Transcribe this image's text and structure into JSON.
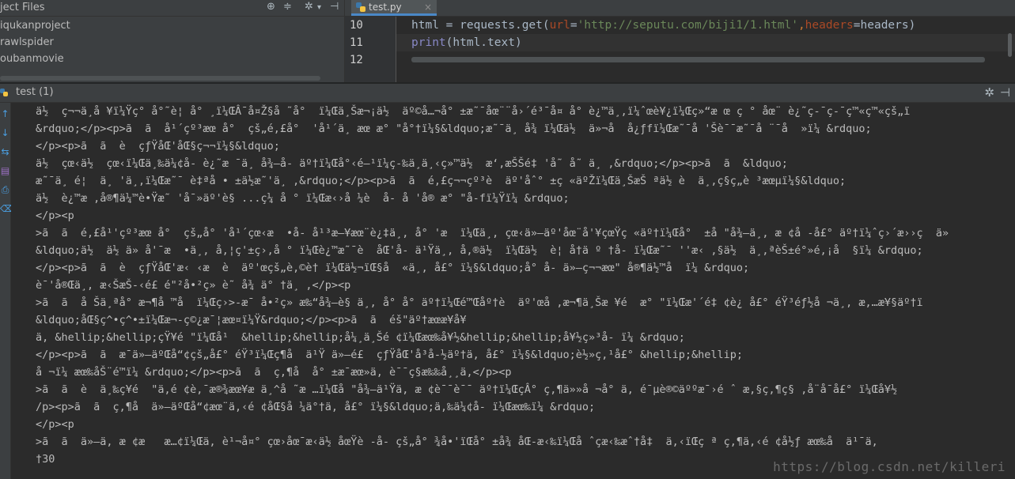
{
  "project_panel": {
    "title": "ject Files",
    "items": [
      "iqukanproject",
      "rawlspider",
      "oubanmovie"
    ]
  },
  "editor": {
    "tab_label": "test.py",
    "line_numbers": [
      "10",
      "11",
      "12"
    ],
    "line10": {
      "var": "html",
      "eq": " = ",
      "obj": "requests.",
      "fn": "get",
      "open": "(",
      "p1": "url",
      "eq1": "=",
      "url": "'http://seputu.com/biji1/1.html'",
      "comma": ",",
      "p2": "headers",
      "eq2": "=",
      "arg2": "headers",
      "close": ")"
    },
    "line11": {
      "fn": "print",
      "open": "(",
      "obj": "html.",
      "attr": "text",
      "close": ")"
    }
  },
  "run_panel": {
    "tab_label": "test (1)",
    "output_lines": [
      "ä½  ç¬¬ä¸å ¥ï¼Ÿç° å°˜è¦ å° ¸ï¼ŒÂ¯å¤Ž§å ˜å°  ï¼Œä¸Šæ¬¡ä½  äº©å…¬å° ±æ˜¯åœ¨¨å›´é³¯å¤ å° è¿™ä¸‚ï¼ˆœè¥¿ï¼Œç»“æ œ ç ° åœ¨ è¿˜ç-¯ç-¯ç™«ç™«çš„ï",
      "&rdquo;</p><p>ã  ã  å¹´çº³æœ å°  çš„é‚£å°  'å¹´ä¸ æœ æ° \"å°†ï¼§&ldquo;æ˜¯ä¸ å¾ ï¼Œä½  ä»¬å  å¿ƒfï¼Œæ˜¯å 'Šè¯¯æ˜¯å ¨¯å  »ï¼ &rdquo;",
      "</p><p>ã  ã  è  çƒŸåŒ'åŒ§ç¬¬ï¼§&ldquo;",
      "ä½  çœ‹ä½  çœ‹ï¼Œä¸‰ä¼¢å- è¿˜æ ¯ä¸ å¾–å- äº†ï¼Œå°‹é—¹ï¼ç-‰ä¸ä¸‹ç»™ä½  æ‘‚æŠŠé‡ 'å˜ å˜ ä¸ ,&rdquo;</p><p>ã  ã  &ldquo;",
      "æ˜¯ä¸ é¦  ä¸ 'ä¸‚ï¼Œæ˜¯ è‡ªå • ±ä½æ˜'ä¸ ,&rdquo;</p><p>ã  ã  é‚£ç¬¬çº³è  äº'åˆ° ±ç «äºŽï¼Œä¸ŠæŠ ªä½ è  ä¸‚ç§ç„è ³æœµï¼§&ldquo;",
      "ä½  è¿™æ ,å®¶ä¼™è•Ÿæ˜ 'å¯»äº'è§ ...ç¼ å ° ï¼Œæ‹›å ¼è  å- å 'å® æ° \"å-fï¼Ÿï¼ &rdquo;",
      "</p><p",
      ">ã  ã  é,£å¹'çº³æœ å°  çš„å° 'å¹´çœ‹æ  •å- å¹³æ—¥æœ¨è¿‡ä¸, å° 'æ  ï¼Œä¸, çœ‹ä»–äº'åœ¨å'¥çœŸç «äº†ï¼Œå°  ±å \"å¾–ä¸, æ ¢å -å£° äº†ï¼ˆç›´æ››ç  ä»",
      "&ldquo;ä½  ä½ ä» å'¯æ  •ä¸, å,¦ç'±ç›,å ° ï¼Œè¿™æ˜¯è  åŒ'å- ä¹Ÿä¸, å,®ä½  ï¼Œä½  è¦ å†ä º †å- ï¼Œæ˜¯ ''æ‹ ,§ä½  ä¸,ªèŠ±é°»é,¡å  §ï¼ &rdquo;",
      "</p><p>ã  ã  è  çƒŸåŒ'æ‹ ‹æ  è  äº'œçš„è,©è† ï¼Œä½¬ïŒ§å  «ä¸, å£° ï¼§&ldquo;å° å- ä»–ç¬¬æœ\" å®¶ä½™å  ï¼ &rdquo;",
      "è¯'å®Œä¸, æ‹ŠæŠ-‹é£ é\"²å•²ç» è˜ å¾ ä° †ä¸ ,</p><p",
      ">ã  ã  å Šä¸ªå° æ¬¶å ™å  ï¼Œç›>-æ¯ å•²ç» æ‰“å¾–è§ ä¸, å° å° äº†ï¼Œé™Œåº†è  äº'œå ,æ¬¶ä¸Šæ ¥é  æ° \"ï¼Œæ'´é‡ ¢è¿ å£° éŸ³éƒ½å ¬ä¸, æ,…æ¥§äº†ï",
      "&ldquo;åŒ§ç^•ç^•±ï¼Œæ¬-ç©¿æ¯¦æœ¤ï¼Ÿ&rdquo;</p><p>ã  ã  éš\"äº†æœæ¥å¥",
      "ä, &hellip;&hellip;çŸ¥é \"ï¼Œå¹  &hellip;&hellip;å¼¸ä¸Šé ¢ï¼Œæœ‰å¥½&hellip;&hellip;å¥½ç»³å- ï¼ &rdquo;",
      "</p><p>ã  ã  æ¯ä»–äºŒå“¢çš„å£° éŸ³ï¼Œç¶å  ä¹Ÿ ä»–é£  çƒŸåŒ'å³å-½äº†ä, å£° ï¼§&ldquo;è½»ç,¹å£° &hellip;&hellip;",
      "å ¬ï¼ æœ‰åŠ¨é™ï¼ &rdquo;</p><p>ã  ã  ç,¶å  å° ±æ¯æœ»ä, è¯¯ç§æ‰‰å¸¸ä,</p><p",
      ">ã  ã  è  ä¸‰ç¥é  \"ä,é ¢è,¯æ®¾æœ¥æ ä¸^å ˜æ …ï¼Œå \"å¾–ä¹Ÿä, æ ¢è¯¯è¯¯ äº†ï¼ŒçÂ° ç,¶ä»»å ¬å° ä, é¯µè®©äººæ¯›é ˆ æ,§ç,¶ç§ ,å¨å¯å£° ï¼Œå¥½",
      "/p><p>ã  ã  ç,¶å  ä»–äºŒå“¢æœ¨ä,‹é ¢åŒ§å ¼ä°†ä, å£° ï¼§&ldquo;ä,‰ä¼¢å- ï¼Œæœ‰ï¼ &rdquo;",
      "</p><p",
      ">ã  ã  ä»–ä, æ ¢æ   æ…¢ï¼Œä, è¹¬å¤° çœ›åœ¯æ‹ä½ åœŸè -å- çš„å° ¾å•'ïŒå° ±å¾ åŒ-æ‹‰ï¼Œå ˆçæ‹‰æˆ†å‡  ä,‹ïŒç ª ç,¶ä,‹é ¢å½ƒ æœ‰å  ä¹¯ä,",
      "†30"
    ],
    "watermark": "https://blog.csdn.net/killeri"
  }
}
